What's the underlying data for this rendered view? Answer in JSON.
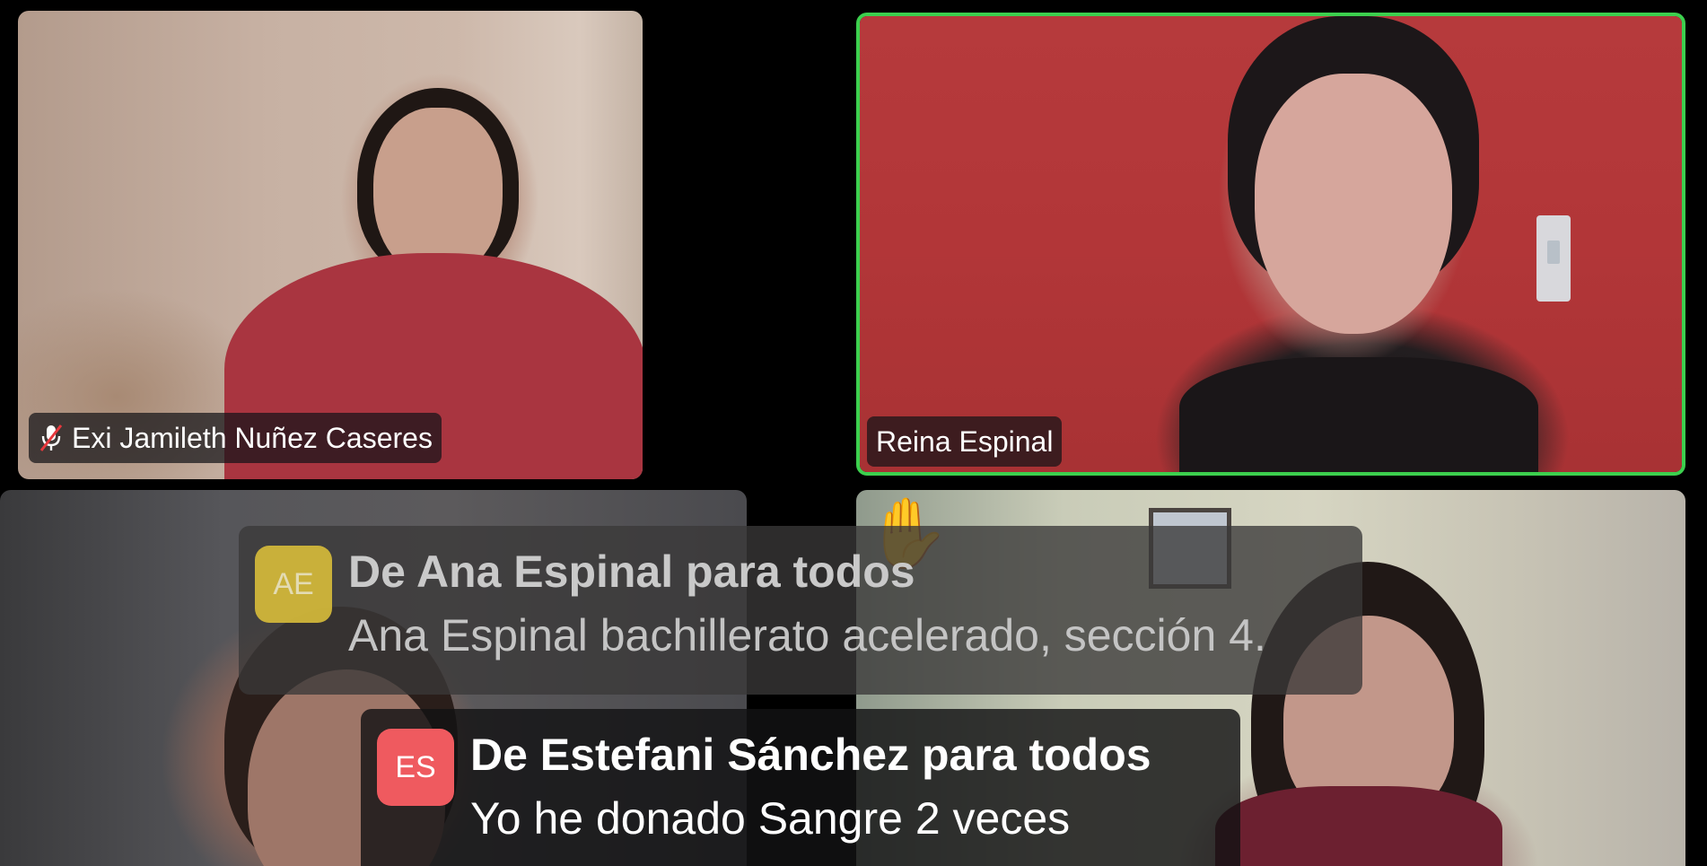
{
  "participants": [
    {
      "name": "Exi Jamileth Nuñez Caseres",
      "muted": true
    },
    {
      "name": "Reina Espinal",
      "active_speaker": true
    },
    {
      "name": ""
    },
    {
      "name": "",
      "raised_hand": true
    }
  ],
  "chat_notifications": [
    {
      "avatar_initials": "AE",
      "title": "De Ana Espinal para todos",
      "message": "Ana Espinal bachillerato acelerado, sección 4."
    },
    {
      "avatar_initials": "ES",
      "title": "De Estefani Sánchez para todos",
      "message": "Yo he donado Sangre 2 veces"
    }
  ],
  "icons": {
    "muted_mic": "muted-mic-icon",
    "raise_hand": "raise-hand-icon"
  },
  "colors": {
    "active_speaker_border": "#3ccf4e",
    "avatar_ae": "#d8bd3a",
    "avatar_es": "#ef5a5f"
  }
}
